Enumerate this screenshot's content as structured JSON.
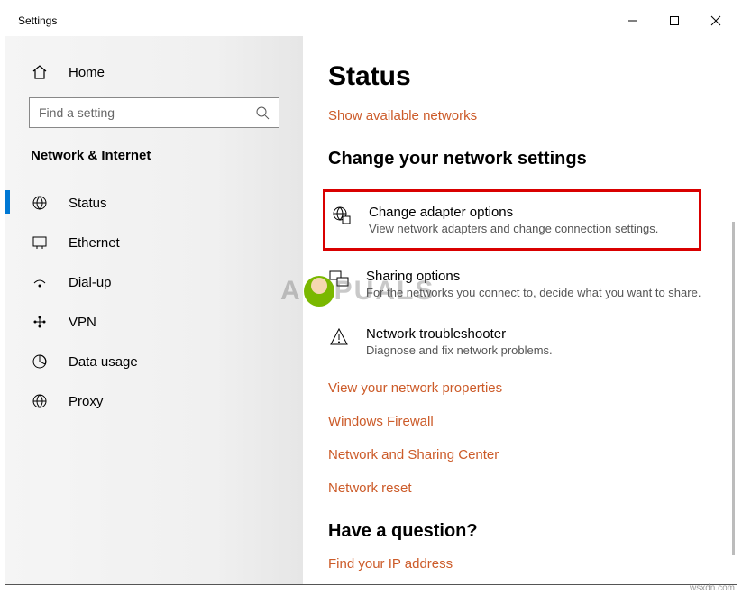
{
  "window": {
    "title": "Settings"
  },
  "sidebar": {
    "home_label": "Home",
    "search_placeholder": "Find a setting",
    "category": "Network & Internet",
    "items": [
      {
        "label": "Status"
      },
      {
        "label": "Ethernet"
      },
      {
        "label": "Dial-up"
      },
      {
        "label": "VPN"
      },
      {
        "label": "Data usage"
      },
      {
        "label": "Proxy"
      }
    ]
  },
  "main": {
    "title": "Status",
    "show_networks": "Show available networks",
    "change_heading": "Change your network settings",
    "options": [
      {
        "title": "Change adapter options",
        "sub": "View network adapters and change connection settings."
      },
      {
        "title": "Sharing options",
        "sub": "For the networks you connect to, decide what you want to share."
      },
      {
        "title": "Network troubleshooter",
        "sub": "Diagnose and fix network problems."
      }
    ],
    "links": [
      "View your network properties",
      "Windows Firewall",
      "Network and Sharing Center",
      "Network reset"
    ],
    "question_heading": "Have a question?",
    "question_link": "Find your IP address"
  },
  "watermark": {
    "pre": "A",
    "post": "PUALS"
  },
  "attribution": "wsxdn.com"
}
